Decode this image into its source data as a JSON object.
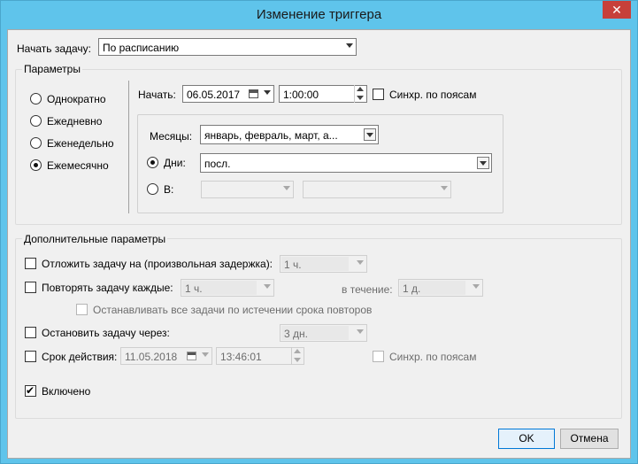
{
  "dialog": {
    "title": "Изменение триггера",
    "close_glyph": "✕"
  },
  "begin": {
    "label": "Начать задачу:",
    "value": "По расписанию"
  },
  "params": {
    "group_title": "Параметры",
    "schedule_types": [
      "Однократно",
      "Ежедневно",
      "Еженедельно",
      "Ежемесячно"
    ],
    "selected": "Ежемесячно",
    "start_label": "Начать:",
    "start_date": "06.05.2017",
    "start_time": "1:00:00",
    "sync_label": "Синхр. по поясам",
    "months_label": "Месяцы:",
    "months_value": "январь, февраль, март, а...",
    "days_label": "Дни:",
    "days_value": "посл.",
    "on_label": "В:"
  },
  "advanced": {
    "group_title": "Дополнительные параметры",
    "delay_label": "Отложить задачу на (произвольная задержка):",
    "delay_value": "1 ч.",
    "repeat_label": "Повторять задачу каждые:",
    "repeat_value": "1 ч.",
    "duration_label": "в течение:",
    "duration_value": "1 д.",
    "stop_all_label": "Останавливать все задачи по истечении срока повторов",
    "stop_after_label": "Остановить задачу через:",
    "stop_after_value": "3 дн.",
    "expire_label": "Срок действия:",
    "expire_date": "11.05.2018",
    "expire_time": "13:46:01",
    "expire_sync_label": "Синхр. по поясам",
    "enabled_label": "Включено",
    "check_glyph": "✔"
  },
  "buttons": {
    "ok": "OK",
    "cancel": "Отмена"
  }
}
